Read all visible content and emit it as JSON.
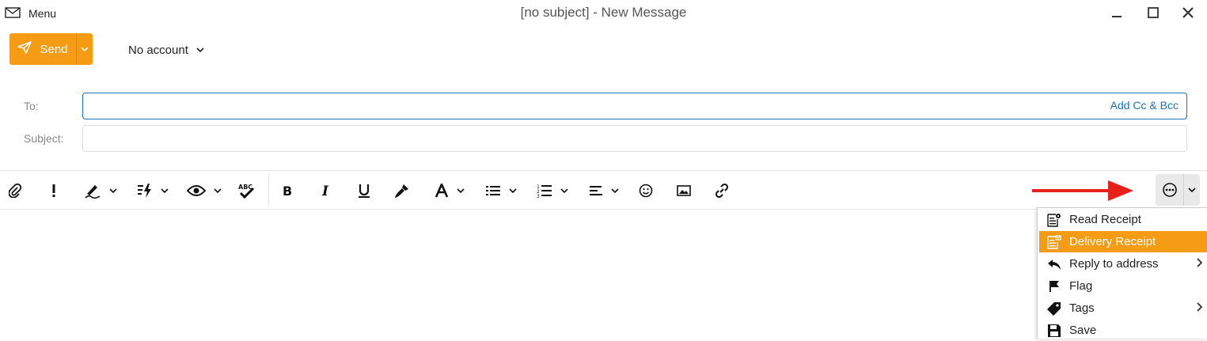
{
  "window": {
    "title": "[no subject] - New Message",
    "menu_label": "Menu"
  },
  "colors": {
    "accent": "#f59b14",
    "link": "#1a73b8",
    "arrow": "#e8201a"
  },
  "send": {
    "label": "Send"
  },
  "account": {
    "label": "No account"
  },
  "fields": {
    "to_label": "To:",
    "to_value": "",
    "add_cc": "Add Cc & Bcc",
    "subject_label": "Subject:",
    "subject_value": ""
  },
  "toolbar": {
    "items": [
      "attach-icon",
      "priority-icon",
      "signature-icon",
      "quick-text-icon",
      "preview-icon",
      "spellcheck-icon",
      "bold-icon",
      "italic-icon",
      "underline-icon",
      "format-painter-icon",
      "font-color-icon",
      "bullet-list-icon",
      "numbered-list-icon",
      "align-icon",
      "emoji-icon",
      "image-icon",
      "link-icon",
      "more-icon"
    ]
  },
  "more_menu": {
    "items": [
      {
        "label": "Read Receipt",
        "icon": "read-receipt-icon",
        "submenu": false
      },
      {
        "label": "Delivery Receipt",
        "icon": "delivery-receipt-icon",
        "submenu": false,
        "highlighted": true
      },
      {
        "label": "Reply to address",
        "icon": "reply-icon",
        "submenu": true
      },
      {
        "label": "Flag",
        "icon": "flag-icon",
        "submenu": false
      },
      {
        "label": "Tags",
        "icon": "tag-icon",
        "submenu": true
      },
      {
        "label": "Save",
        "icon": "save-icon",
        "submenu": false
      }
    ]
  }
}
